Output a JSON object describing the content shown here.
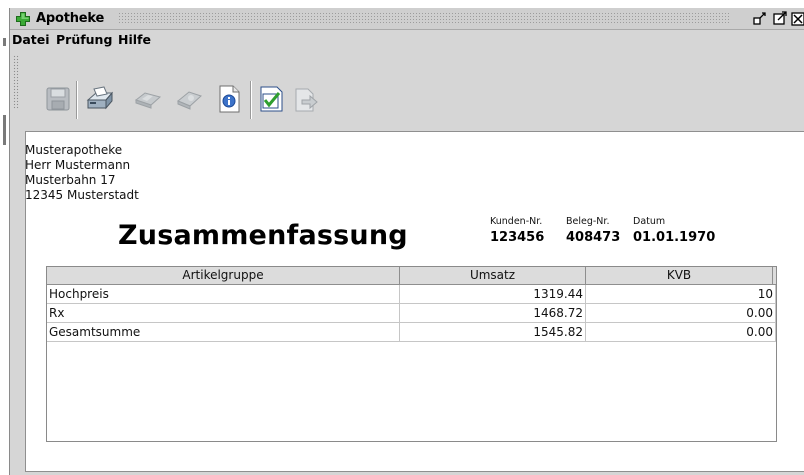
{
  "window": {
    "title": "Apotheke",
    "icons": {
      "app": "green-cross-icon",
      "restore": "restore-window-icon",
      "maximize": "maximize-window-icon",
      "close": "close-window-icon"
    }
  },
  "menu": {
    "items": [
      {
        "label": "Datei"
      },
      {
        "label": "Prüfung"
      },
      {
        "label": "Hilfe"
      }
    ]
  },
  "toolbar": {
    "buttons": [
      {
        "icon": "save-icon",
        "enabled": false
      },
      {
        "icon": "print-icon",
        "enabled": true
      },
      {
        "icon": "scan-icon",
        "enabled": false
      },
      {
        "icon": "eraser-icon",
        "enabled": false
      },
      {
        "icon": "info-icon",
        "enabled": true
      },
      {
        "icon": "check-icon",
        "enabled": true
      },
      {
        "icon": "export-icon",
        "enabled": false
      }
    ]
  },
  "document": {
    "address": [
      "Musterapotheke",
      "Herr Mustermann",
      "Musterbahn 17",
      "12345 Musterstadt"
    ],
    "heading": "Zusammenfassung",
    "meta": {
      "kunden_label": "Kunden-Nr.",
      "kunden_value": "123456",
      "beleg_label": "Beleg-Nr.",
      "beleg_value": "408473",
      "datum_label": "Datum",
      "datum_value": "01.01.1970"
    }
  },
  "table": {
    "headers": [
      "Artikelgruppe",
      "Umsatz",
      "KVB"
    ],
    "rows": [
      [
        "Hochpreis",
        "1319.44",
        "10"
      ],
      [
        "Rx",
        "1468.72",
        "0.00"
      ],
      [
        "Gesamtsumme",
        "1545.82",
        "0.00"
      ]
    ]
  },
  "colors": {
    "accent_green": "#2f9e2f",
    "window_bg": "#d6d6d6",
    "panel_bg": "#ffffff"
  }
}
